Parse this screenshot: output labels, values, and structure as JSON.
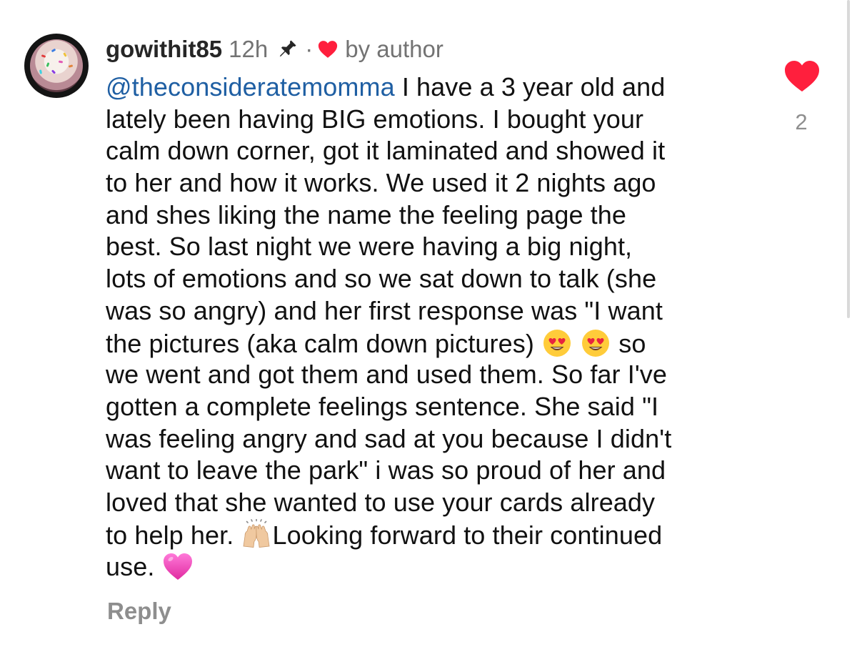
{
  "comment": {
    "username": "gowithit85",
    "time": "12h",
    "separator": "·",
    "liked_by_author": "by author",
    "mention": "@theconsideratemomma",
    "lines": [
      " I have a 3 year old and",
      "lately been having BIG emotions. I bought your",
      "calm down corner, got it laminated and showed it",
      "to her and how it works. We used it 2 nights ago",
      "and shes liking the name the feeling page the",
      "best. So last night we were having a big night,",
      "lots of emotions and so we sat down to talk (she",
      "was so angry) and her first response was \"I want",
      "the pictures (aka calm down pictures) ",
      "we went and got them and used them. So far I've",
      "gotten a complete feelings sentence. She said \"I",
      "was feeling angry and sad at you because I didn't",
      "want to leave the park\" i was so proud of her and",
      "loved that she wanted to use your cards already",
      "to help her. ",
      "use. "
    ],
    "line9_tail": " so",
    "line15_tail": "Looking forward to their continued",
    "like_count": "2",
    "reply_label": "Reply"
  },
  "icons": {
    "pin": "pin-icon",
    "heart": "heart-icon",
    "emoji_heart_eyes": "heart-eyes-emoji",
    "emoji_raising_hands": "raising-hands-emoji",
    "emoji_pink_heart": "pink-heart-emoji"
  },
  "colors": {
    "mention": "#1f5fa3",
    "heart": "#ff1f3d",
    "muted": "#737373"
  }
}
